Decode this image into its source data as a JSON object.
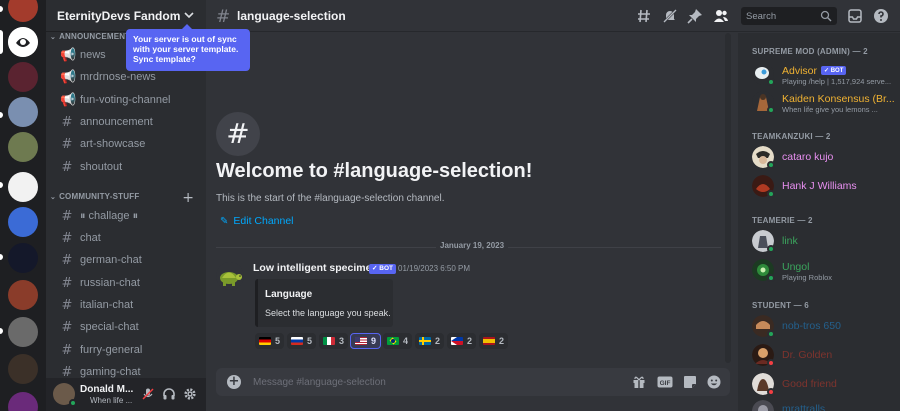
{
  "guild": {
    "name": "EternityDevs Fandom"
  },
  "tooltip": {
    "text": "Your server is out of sync with your server template. Sync template?"
  },
  "categories": [
    {
      "name": "ANNOUNCEMENT"
    },
    {
      "name": "COMMUNITY-STUFF"
    }
  ],
  "channels": [
    {
      "label": "news",
      "icon": "megaphone-icon"
    },
    {
      "label": "mrdrnose-news",
      "icon": "megaphone-icon"
    },
    {
      "label": "fun-voting-channel",
      "icon": "megaphone-icon"
    },
    {
      "label": "announcement",
      "icon": "hash-icon"
    },
    {
      "label": "art-showcase",
      "icon": "hash-icon"
    },
    {
      "label": "shoutout",
      "icon": "hash-icon"
    },
    {
      "label": "⏸ challage ⏸",
      "icon": "hash-icon"
    },
    {
      "label": "chat",
      "icon": "hash-icon"
    },
    {
      "label": "german-chat",
      "icon": "hash-icon"
    },
    {
      "label": "russian-chat",
      "icon": "hash-icon"
    },
    {
      "label": "italian-chat",
      "icon": "hash-icon"
    },
    {
      "label": "special-chat",
      "icon": "hash-icon"
    },
    {
      "label": "furry-general",
      "icon": "hash-icon"
    },
    {
      "label": "gaming-chat",
      "icon": "hash-icon"
    }
  ],
  "user": {
    "name": "Donald M...",
    "status": "When life ..."
  },
  "topbar": {
    "channel": "language-selection",
    "search_placeholder": "Search"
  },
  "welcome": {
    "title": "Welcome to #language-selection!",
    "subtitle": "This is the start of the #language-selection channel.",
    "edit": "Edit Channel"
  },
  "date_divider": "January 19, 2023",
  "message": {
    "author": "Low intelligent specimen",
    "bot_tag": "✓ BOT",
    "timestamp": "01/19/2023 6:50 PM",
    "embed_title": "Language",
    "embed_desc": "Select the language you speak."
  },
  "reactions": [
    {
      "flag": "de",
      "count": "5"
    },
    {
      "flag": "ru",
      "count": "5"
    },
    {
      "flag": "it",
      "count": "3"
    },
    {
      "flag": "us",
      "count": "9"
    },
    {
      "flag": "br",
      "count": "4"
    },
    {
      "flag": "se",
      "count": "2"
    },
    {
      "flag": "ph",
      "count": "2"
    },
    {
      "flag": "es",
      "count": "2"
    }
  ],
  "composer": {
    "placeholder": "Message #language-selection"
  },
  "member_groups": [
    {
      "heading": "SUPREME MOD (ADMIN) — 2"
    },
    {
      "heading": "TEAMKANZUKI — 2"
    },
    {
      "heading": "TEAMERIE — 2"
    },
    {
      "heading": "STUDENT — 6"
    }
  ],
  "members": [
    {
      "name": "Advisor",
      "bot": "✓ BOT",
      "status": "Playing /help | 1,517,924 serve...",
      "color": "#f0b232",
      "presence": "#23a55a"
    },
    {
      "name": "Kaiden Konsensus (Br...",
      "status": "When life give you lemons ...",
      "color": "#f0b232",
      "presence": "#23a55a"
    },
    {
      "name": "cataro kujo",
      "status": "",
      "color": "#e88ff0",
      "presence": "#23a55a"
    },
    {
      "name": "Hank J Williams",
      "status": "",
      "color": "#e88ff0",
      "presence": "#23a55a"
    },
    {
      "name": "link",
      "status": "",
      "color": "#3ba55d",
      "presence": "#23a55a"
    },
    {
      "name": "Ungol",
      "status": "Playing Roblox",
      "color": "#3ba55d",
      "presence": "#23a55a"
    },
    {
      "name": "nob-tros 650",
      "status": "",
      "color": "#1e88d6",
      "presence": "#23a55a"
    },
    {
      "name": "Dr. Golden",
      "status": "",
      "color": "#c0392b",
      "presence": "#f23f43"
    },
    {
      "name": "Good friend",
      "status": "",
      "color": "#c0392b",
      "presence": "#f23f43"
    },
    {
      "name": "mrattralls",
      "status": "",
      "color": "#1e88d6",
      "presence": "#23a55a"
    }
  ]
}
